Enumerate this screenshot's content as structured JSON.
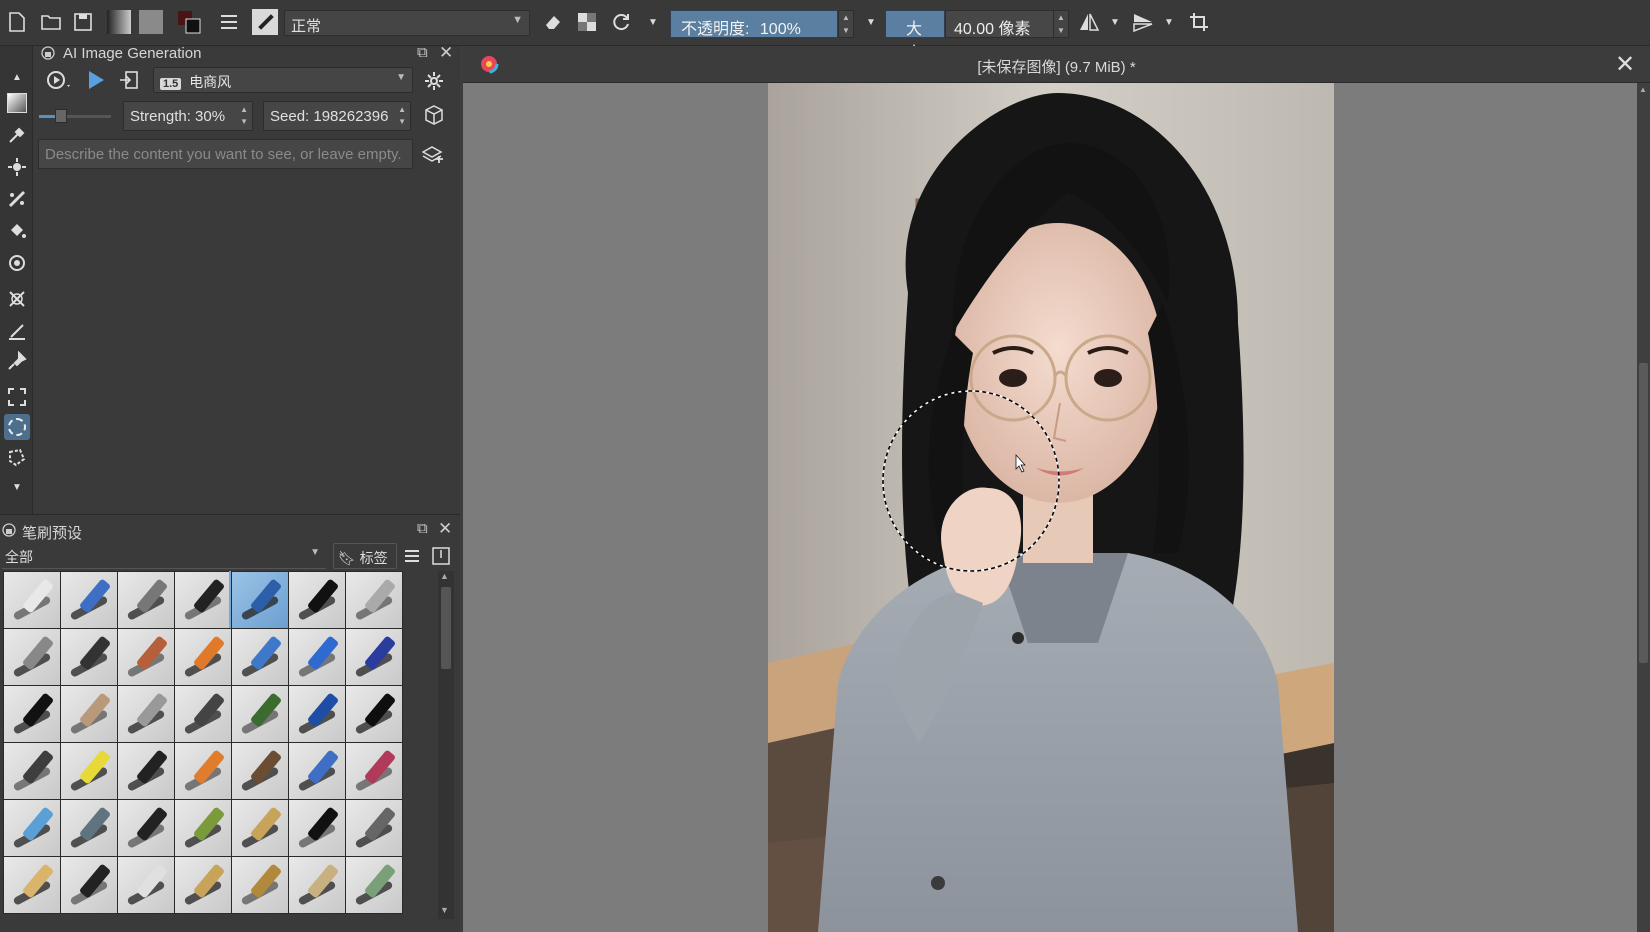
{
  "toolbar": {
    "blend_mode": "正常",
    "opacity_label": "不透明度:",
    "opacity_value": "100%",
    "size_label": "大小:",
    "size_value": "40.00 像素"
  },
  "ai_panel": {
    "title": "AI Image Generation",
    "model_tag": "1.5",
    "model_name": "电商风",
    "strength": "Strength: 30%",
    "seed": "Seed: 198262396",
    "prompt_placeholder": "Describe the content you want to see, or leave empty."
  },
  "brush_panel": {
    "title": "笔刷预设",
    "filter": "全部",
    "tag_label": "标签"
  },
  "canvas": {
    "tab_title": "[未保存图像] (9.7 MiB) *"
  },
  "colors": {
    "accent": "#5a7fa0",
    "panel": "#3a3a3a",
    "canvas_bg": "#7c7c7c"
  }
}
